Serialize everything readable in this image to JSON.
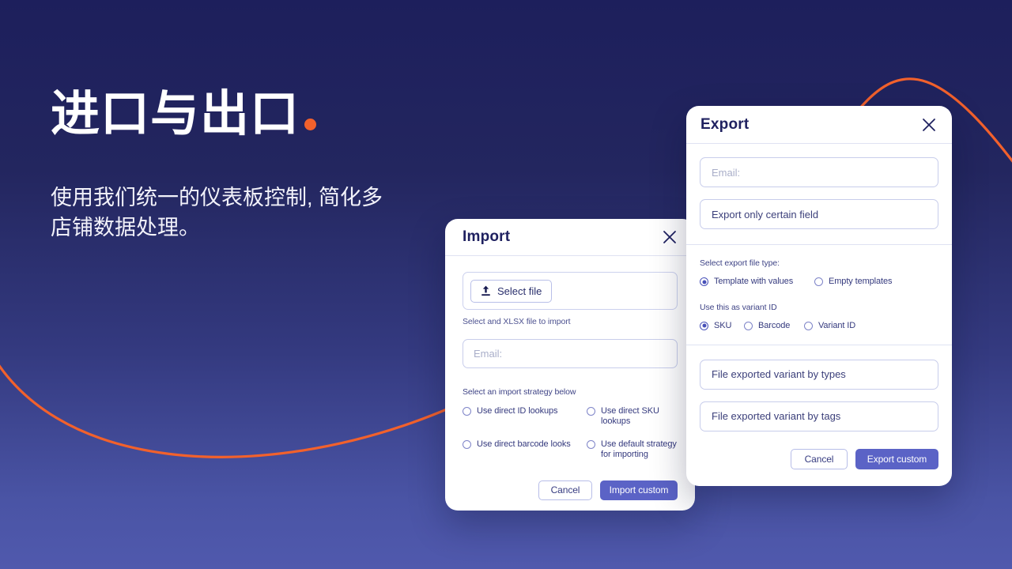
{
  "theme": {
    "bg_top": "#1d1f5c",
    "bg_bottom": "#5059ad",
    "accent_orange": "#f2612c",
    "primary_indigo": "#5b63c6",
    "title_navy": "#1f2160"
  },
  "hero": {
    "title": "进口与出口",
    "title_dot": "orange-dot",
    "subtitle": "使用我们统一的仪表板控制, 简化多店铺数据处理。"
  },
  "import_modal": {
    "title": "Import",
    "close_icon": "close-icon",
    "select_file": {
      "icon": "upload-icon",
      "label": "Select file"
    },
    "file_helper": "Select and XLSX file to import",
    "email": {
      "placeholder": "Email:",
      "value": ""
    },
    "strategy_label": "Select an import strategy below",
    "strategies": [
      {
        "label": "Use direct ID lookups",
        "checked": false
      },
      {
        "label": "Use direct SKU lookups",
        "checked": false
      },
      {
        "label": "Use direct barcode looks",
        "checked": false
      },
      {
        "label": "Use default strategy for importing",
        "checked": false
      }
    ],
    "cancel_label": "Cancel",
    "submit_label": "Import custom"
  },
  "export_modal": {
    "title": "Export",
    "close_icon": "close-icon",
    "email": {
      "placeholder": "Email:",
      "value": ""
    },
    "certain_field": {
      "value": "Export only certain field"
    },
    "file_type_label": "Select export file type:",
    "file_types": [
      {
        "label": "Template with values",
        "checked": true
      },
      {
        "label": "Empty templates",
        "checked": false
      }
    ],
    "variant_id_label": "Use this as variant ID",
    "variant_ids": [
      {
        "label": "SKU",
        "checked": true
      },
      {
        "label": "Barcode",
        "checked": false
      },
      {
        "label": "Variant ID",
        "checked": false
      }
    ],
    "variant_by_types": {
      "value": "File exported variant by types"
    },
    "variant_by_tags": {
      "value": "File exported variant by tags"
    },
    "cancel_label": "Cancel",
    "submit_label": "Export custom"
  }
}
